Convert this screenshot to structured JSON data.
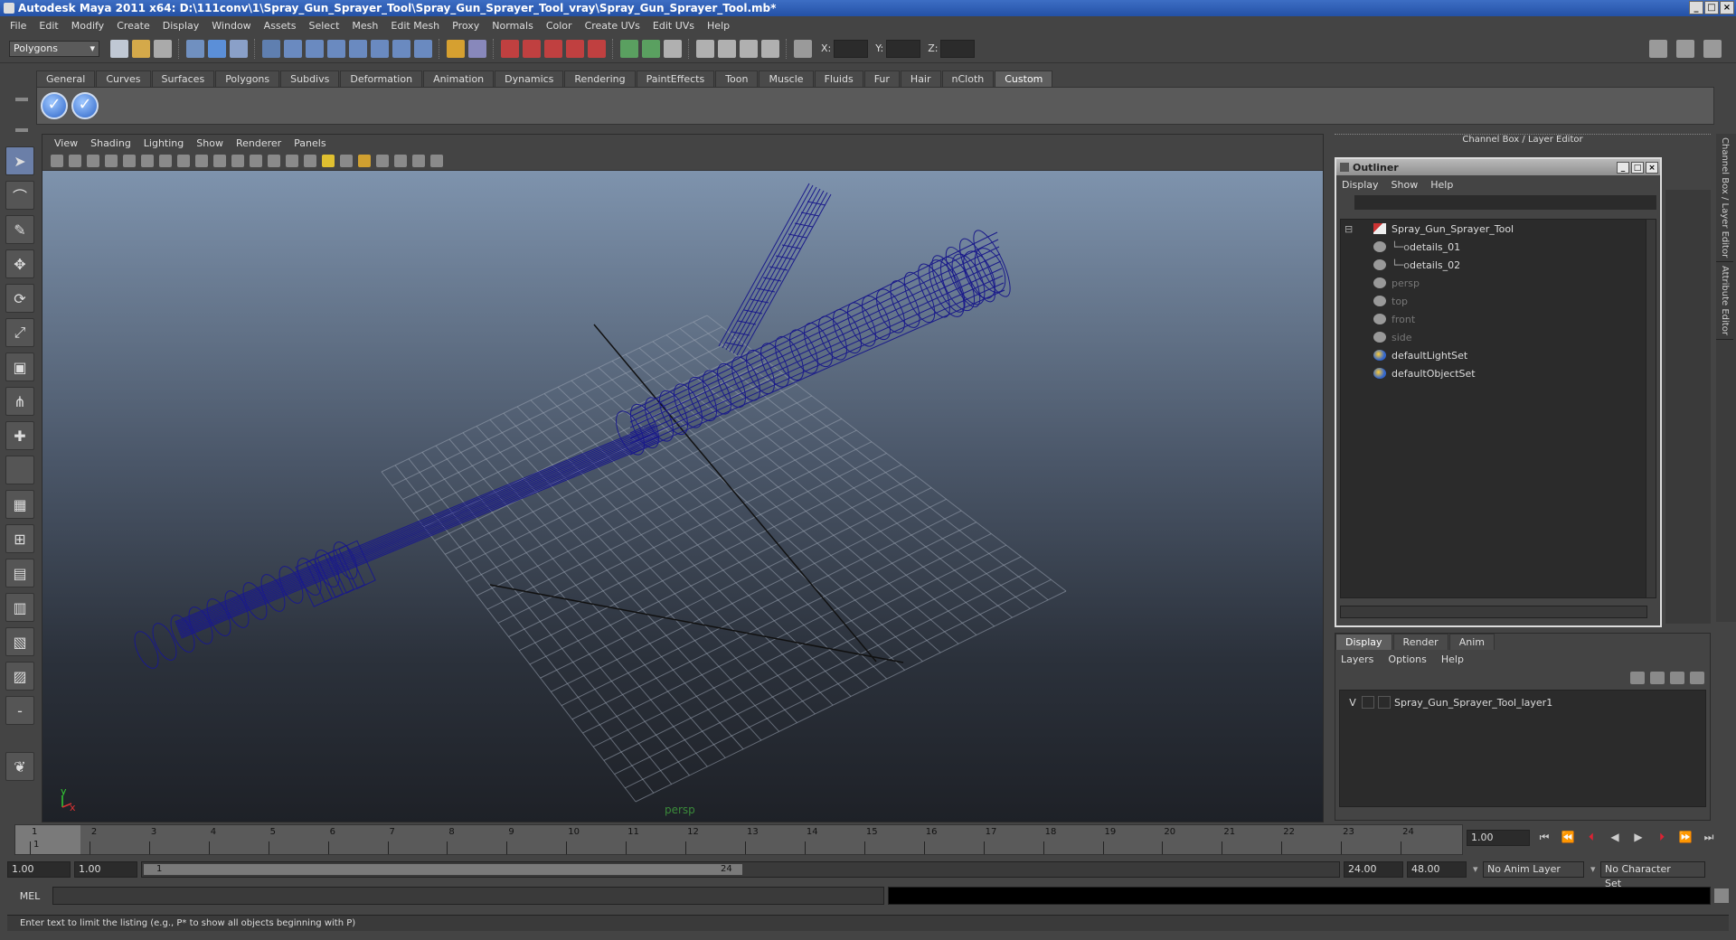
{
  "window": {
    "title": "Autodesk Maya 2011 x64: D:\\111conv\\1\\Spray_Gun_Sprayer_Tool\\Spray_Gun_Sprayer_Tool_vray\\Spray_Gun_Sprayer_Tool.mb*"
  },
  "menubar": [
    "File",
    "Edit",
    "Modify",
    "Create",
    "Display",
    "Window",
    "Assets",
    "Select",
    "Mesh",
    "Edit Mesh",
    "Proxy",
    "Normals",
    "Color",
    "Create UVs",
    "Edit UVs",
    "Help"
  ],
  "toolbar": {
    "mode": "Polygons",
    "x_label": "X:",
    "y_label": "Y:",
    "z_label": "Z:"
  },
  "shelf": {
    "tabs": [
      "General",
      "Curves",
      "Surfaces",
      "Polygons",
      "Subdivs",
      "Deformation",
      "Animation",
      "Dynamics",
      "Rendering",
      "PaintEffects",
      "Toon",
      "Muscle",
      "Fluids",
      "Fur",
      "Hair",
      "nCloth",
      "Custom"
    ],
    "active": "Custom",
    "check_glyph": "✓"
  },
  "viewport": {
    "menu": [
      "View",
      "Shading",
      "Lighting",
      "Show",
      "Renderer",
      "Panels"
    ],
    "camera": "persp",
    "axis_x": "x",
    "axis_y": "y"
  },
  "channel_box": {
    "header": "Channel Box / Layer Editor",
    "side_tabs": [
      "Channel Box / Layer Editor",
      "Attribute Editor"
    ]
  },
  "outliner": {
    "title": "Outliner",
    "menu": [
      "Display",
      "Show",
      "Help"
    ],
    "items": [
      {
        "label": "Spray_Gun_Sprayer_Tool",
        "indent": 0,
        "type": "mesh",
        "dim": false
      },
      {
        "label": "details_01",
        "indent": 1,
        "type": "obj",
        "dim": false
      },
      {
        "label": "details_02",
        "indent": 1,
        "type": "obj",
        "dim": false
      },
      {
        "label": "persp",
        "indent": 0,
        "type": "cam",
        "dim": true
      },
      {
        "label": "top",
        "indent": 0,
        "type": "cam",
        "dim": true
      },
      {
        "label": "front",
        "indent": 0,
        "type": "cam",
        "dim": true
      },
      {
        "label": "side",
        "indent": 0,
        "type": "cam",
        "dim": true
      },
      {
        "label": "defaultLightSet",
        "indent": 0,
        "type": "set",
        "dim": false
      },
      {
        "label": "defaultObjectSet",
        "indent": 0,
        "type": "set",
        "dim": false
      }
    ]
  },
  "layer_editor": {
    "tabs": [
      "Display",
      "Render",
      "Anim"
    ],
    "active": "Display",
    "menu": [
      "Layers",
      "Options",
      "Help"
    ],
    "layers": [
      {
        "vis": "V",
        "name": "Spray_Gun_Sprayer_Tool_layer1"
      }
    ]
  },
  "timeline": {
    "ticks": [
      1,
      2,
      3,
      4,
      5,
      6,
      7,
      8,
      9,
      10,
      11,
      12,
      13,
      14,
      15,
      16,
      17,
      18,
      19,
      20,
      21,
      22,
      23,
      24
    ],
    "current": "1",
    "current_field": "1.00"
  },
  "range": {
    "start": "1.00",
    "playback_start": "1.00",
    "slider_start": "1",
    "slider_end": "24",
    "playback_end": "24.00",
    "end": "48.00",
    "anim_layer": "No Anim Layer",
    "char_set": "No Character Set"
  },
  "cmdline": {
    "label": "MEL"
  },
  "help": {
    "text": "Enter text to limit the listing (e.g., P* to show all objects beginning with P)"
  }
}
